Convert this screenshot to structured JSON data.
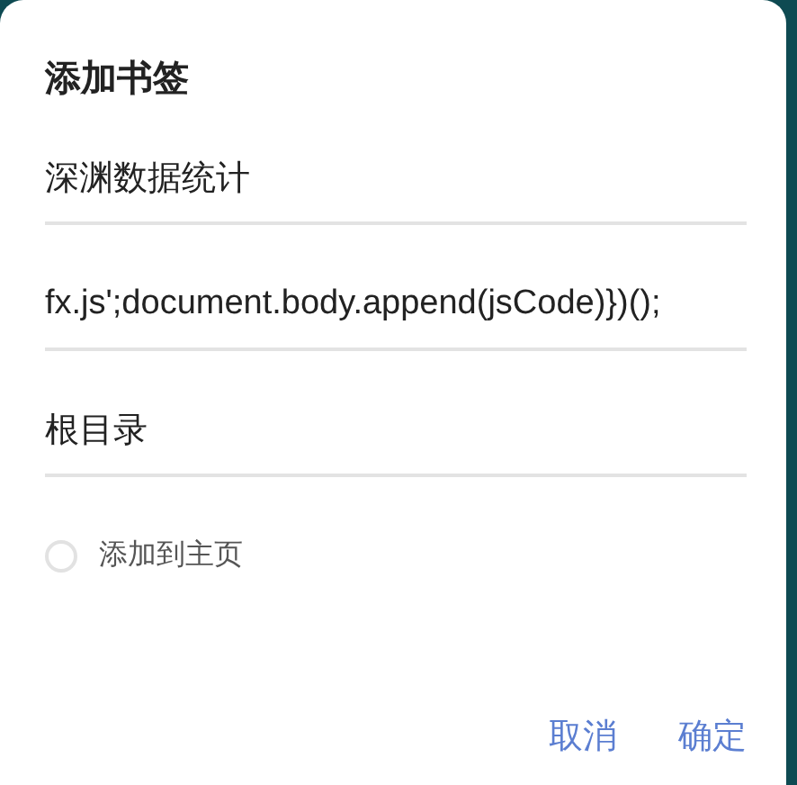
{
  "dialog": {
    "title": "添加书签",
    "fields": [
      {
        "value": "深渊数据统计"
      },
      {
        "value": "fx.js';document.body.append(jsCode)})();"
      },
      {
        "value": "根目录"
      }
    ],
    "checkbox": {
      "label": "添加到主页",
      "checked": false
    },
    "buttons": [
      "取消",
      "确定"
    ]
  }
}
